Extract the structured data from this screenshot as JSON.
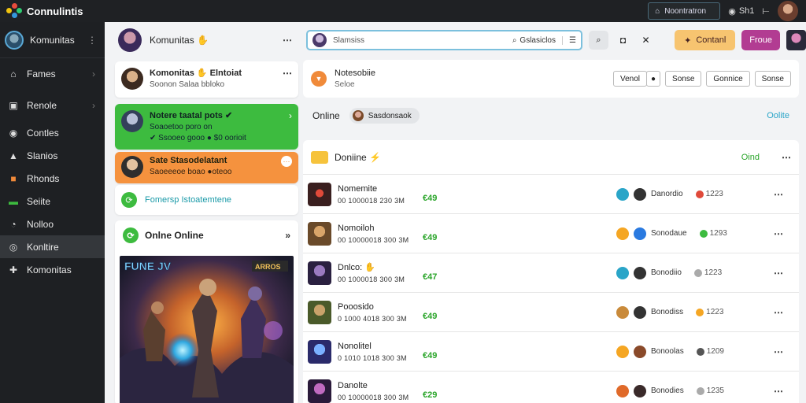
{
  "app": {
    "title": "Connulintis"
  },
  "topbar": {
    "search_label": "Noontratron",
    "mail_label": "Sh1",
    "layout_icon": "⊢"
  },
  "sidebar": {
    "user": "Komunitas",
    "items": [
      {
        "label": "Fames",
        "icon": "home-icon",
        "glyph": "⌂",
        "chevron": true
      },
      {
        "label": "Renole",
        "icon": "briefcase-icon",
        "glyph": "▣",
        "chevron": true
      },
      {
        "label": "Contles",
        "icon": "circle-icon",
        "glyph": "◉",
        "chevron": false
      },
      {
        "label": "Slanios",
        "icon": "lock-icon",
        "glyph": "▲",
        "chevron": false
      },
      {
        "label": "Rhonds",
        "icon": "folder-icon",
        "glyph": "■",
        "chevron": false
      },
      {
        "label": "Seiite",
        "icon": "green-flag-icon",
        "glyph": "▬",
        "chevron": false
      },
      {
        "label": "Nolloo",
        "icon": "chat-icon",
        "glyph": "◔",
        "chevron": false
      },
      {
        "label": "Konltire",
        "icon": "search-icon",
        "glyph": "◎",
        "chevron": false
      },
      {
        "label": "Komonitas",
        "icon": "grid-icon",
        "glyph": "✚",
        "chevron": false
      }
    ],
    "active_index": 7
  },
  "middle": {
    "header_title": "Komunitas ✋",
    "cards": [
      {
        "title": "Komonitas ✋ Elntoiat",
        "sub": "Soonon Salaa bbloko"
      },
      {
        "title": "Notere taatal pots ✔",
        "sub": "Soaoetoo poro on",
        "sub2": "✔ Ssooeo gooo ● $0 oorioit"
      },
      {
        "title": "Sate Stasodelatant",
        "sub": "Saoeeeoe boao ●oteoo"
      }
    ],
    "link_label": "Fomersp Istoatemtene",
    "online_card": {
      "title": "Onlne Online",
      "art_title": "FUNE JV",
      "art_badge": "ARROS"
    }
  },
  "main": {
    "search": {
      "placeholder": "Slamsiss",
      "tag": "Gslasiclos"
    },
    "buttons": {
      "orange": "Contanl",
      "purple": "Froue"
    },
    "notice": {
      "title": "Notesobiie",
      "sub": "Seloe",
      "actions": [
        "Venol",
        "●",
        "Sonse",
        "Gonnice",
        "Sonse"
      ]
    },
    "online_bar": {
      "label": "Online",
      "chip": "Sasdonsaok",
      "link": "Oolite"
    },
    "list": {
      "title": "Doniine ⚡",
      "online": "Oind",
      "rows": [
        {
          "name": "Nomemite",
          "meta": "00 1000018 230 3M",
          "price": "€49",
          "group": "Danordio",
          "stat": "1223"
        },
        {
          "name": "Nomoiloh",
          "meta": "00 10000018 300 3M",
          "price": "€49",
          "group": "Sonodaue",
          "stat": "1293"
        },
        {
          "name": "Dnlco: ✋",
          "meta": "00 1000018 300 3M",
          "price": "€47",
          "group": "Bonodiio",
          "stat": "1223"
        },
        {
          "name": "Pooosido",
          "meta": "0 1000 4018 300 3M",
          "price": "€49",
          "group": "Bonodiss",
          "stat": "1223"
        },
        {
          "name": "Nonolitel",
          "meta": "0 1010 1018 300 3M",
          "price": "€49",
          "group": "Bonoolas",
          "stat": "1209"
        },
        {
          "name": "Danolte",
          "meta": "00 10000018 300 3M",
          "price": "€29",
          "group": "Bonodies",
          "stat": "1235"
        }
      ]
    }
  },
  "colors": {
    "accent_green": "#3dbb3f",
    "accent_orange": "#f5923e",
    "accent_purple": "#b23c92",
    "accent_cyan": "#2aa5c8"
  }
}
